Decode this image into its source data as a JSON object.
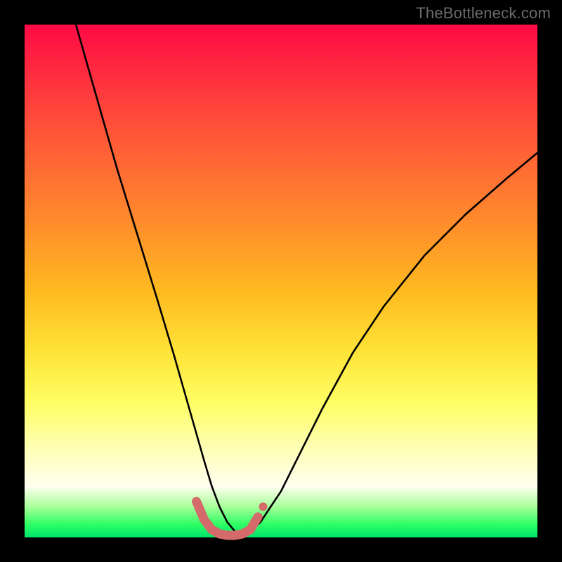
{
  "watermark": "TheBottleneck.com",
  "chart_data": {
    "type": "line",
    "title": "",
    "xlabel": "",
    "ylabel": "",
    "xlim": [
      0,
      100
    ],
    "ylim": [
      0,
      100
    ],
    "grid": false,
    "legend": false,
    "background_gradient": {
      "orientation": "vertical",
      "stops": [
        {
          "pct": 0,
          "color": "#ff0a45"
        },
        {
          "pct": 22,
          "color": "#ff5838"
        },
        {
          "pct": 52,
          "color": "#ffba20"
        },
        {
          "pct": 74,
          "color": "#ffff66"
        },
        {
          "pct": 90,
          "color": "#fffff0"
        },
        {
          "pct": 97,
          "color": "#2dff63"
        },
        {
          "pct": 100,
          "color": "#00e36e"
        }
      ]
    },
    "series": [
      {
        "name": "bottleneck-curve",
        "color": "#000000",
        "width": 2,
        "x": [
          10,
          14,
          18,
          22,
          26,
          29,
          31,
          33,
          35,
          36.5,
          38,
          39.5,
          41,
          42.5,
          44,
          46,
          50,
          54,
          58,
          64,
          70,
          78,
          86,
          94,
          100
        ],
        "y": [
          100,
          86,
          72,
          59,
          46,
          36,
          29,
          22,
          15,
          10,
          6,
          3,
          1.2,
          0.5,
          1.2,
          3,
          9,
          17,
          25,
          36,
          45,
          55,
          63,
          70,
          75
        ]
      },
      {
        "name": "optimal-region-highlight",
        "color": "#d46a6a",
        "width": 10,
        "linecap": "round",
        "x": [
          33.5,
          35,
          36.5,
          38,
          39.5,
          41,
          42.5,
          44,
          45.5
        ],
        "y": [
          7,
          3.5,
          1.5,
          0.7,
          0.4,
          0.4,
          0.7,
          1.5,
          4
        ]
      }
    ],
    "markers": [
      {
        "name": "optimal-point-left",
        "x": 33.5,
        "y": 7,
        "r": 6,
        "color": "#d46a6a"
      },
      {
        "name": "optimal-point-right",
        "x": 46.5,
        "y": 6,
        "r": 6,
        "color": "#d46a6a"
      }
    ]
  }
}
